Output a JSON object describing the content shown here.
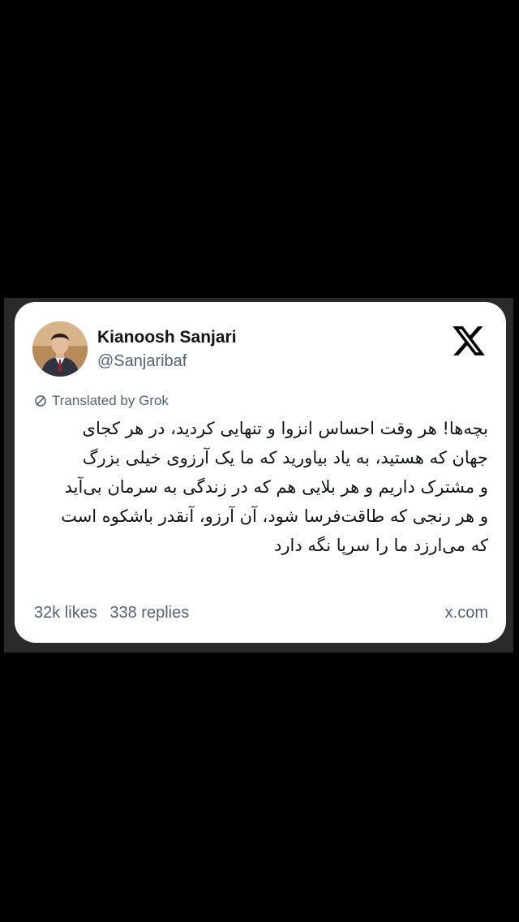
{
  "author": {
    "name": "Kianoosh Sanjari",
    "handle": "@Sanjaribaf"
  },
  "translation_note": "Translated by Grok",
  "body_lines": [
    "بچه‌ها! هر وقت احساس انزوا و تنهایی کردید، در هر کجای",
    "جهان که هستید، به یاد بیاورید که ما یک آرزوی خیلی بزرگ",
    "و مشترک داریم و هر بلایی هم که در زندگی به سرمان بی‌آید",
    "و هر رنجی که طاقت‌فرسا شود، آن آرزو، آنقدر باشکوه است",
    "که می‌ارزد ما را سرپا نگه دارد"
  ],
  "footer": {
    "likes": "32k likes",
    "replies": "338 replies",
    "source": "x.com"
  },
  "icons": {
    "brand": "x-logo-icon",
    "translate": "translate-icon"
  },
  "colors": {
    "background": "#000000",
    "card": "#ffffff",
    "primary_text": "#0f1419",
    "secondary_text": "#536471"
  }
}
